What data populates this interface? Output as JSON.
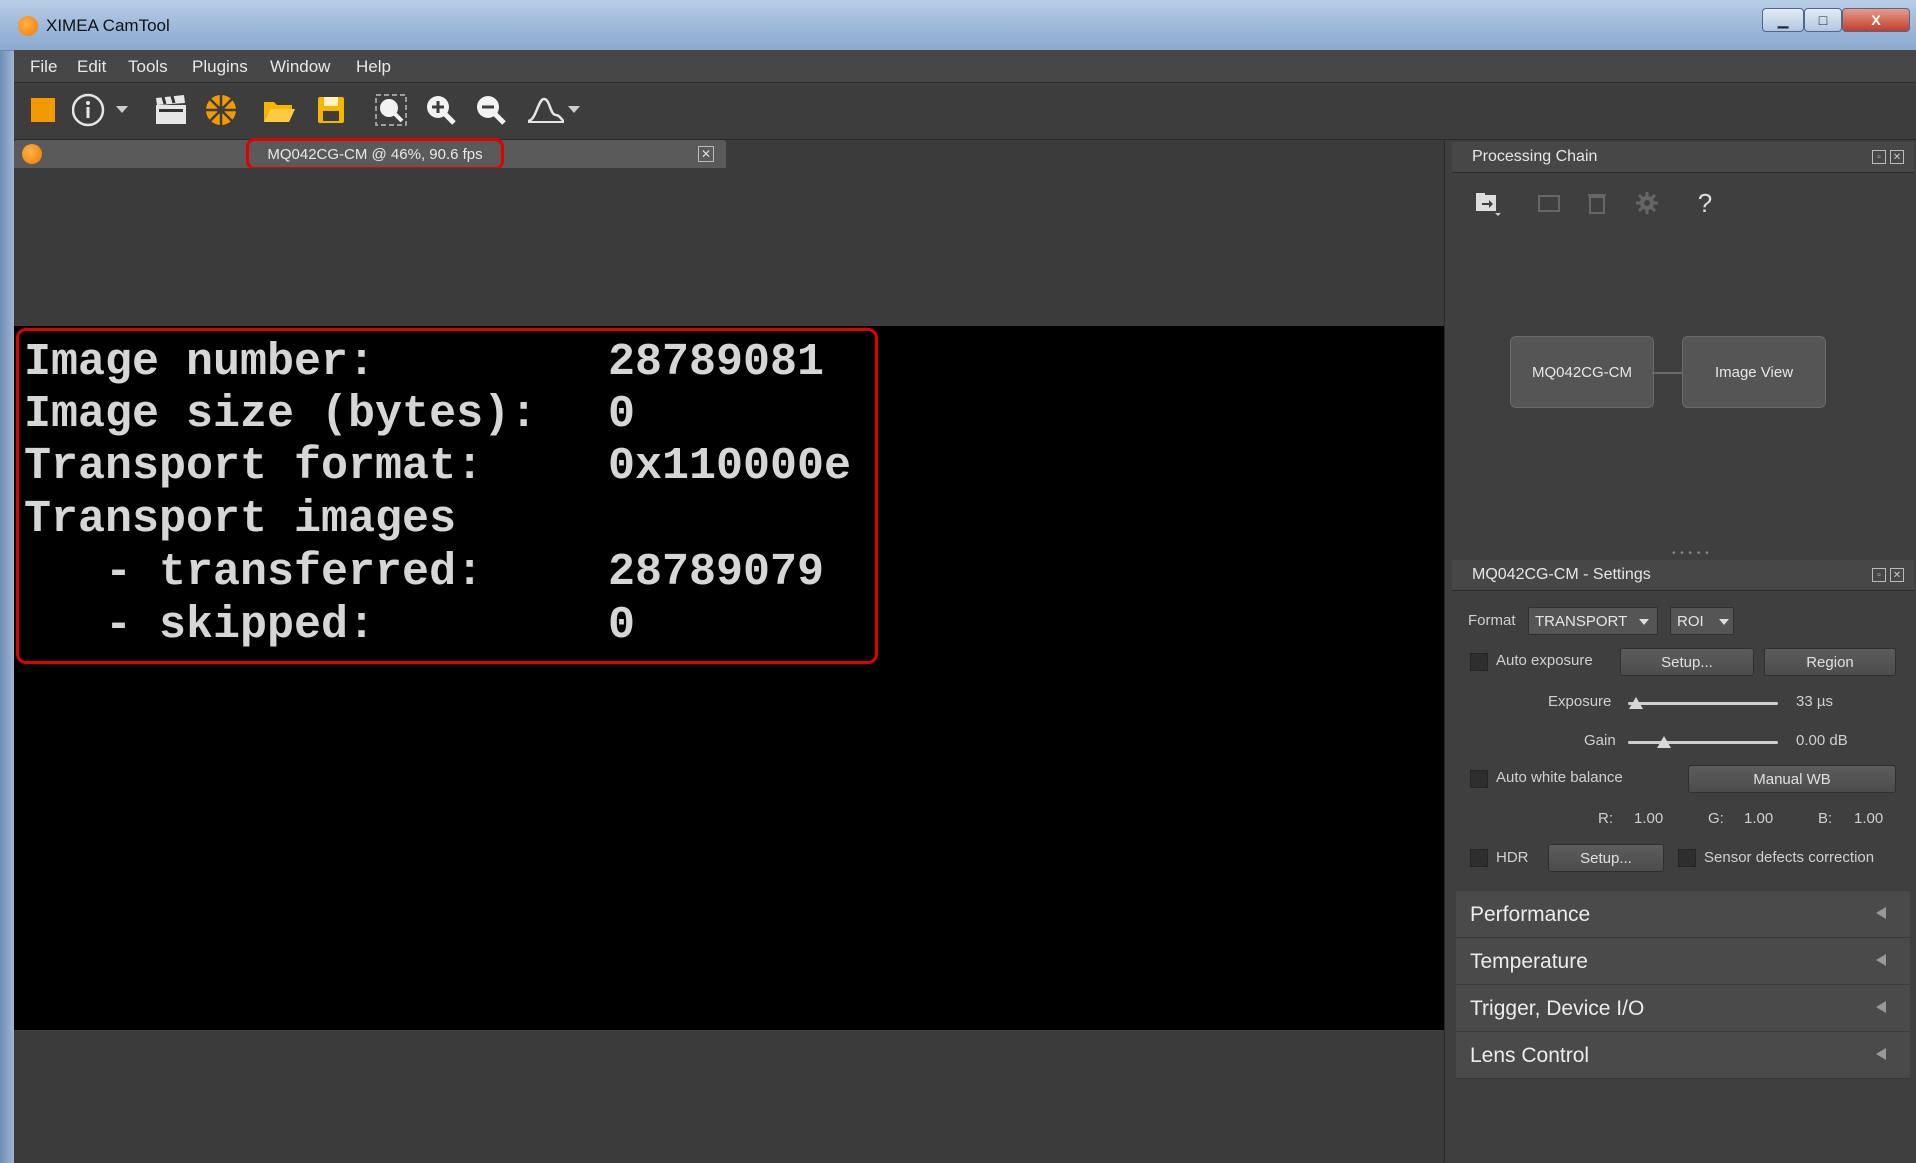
{
  "window": {
    "title": "XIMEA CamTool",
    "min_label": "▁",
    "max_label": "□",
    "close_label": "X"
  },
  "menu": [
    "File",
    "Edit",
    "Tools",
    "Plugins",
    "Window",
    "Help"
  ],
  "toolbar": {
    "icons": [
      "stop-icon",
      "info-icon",
      "record-icon",
      "aperture-icon",
      "open-folder-icon",
      "save-icon",
      "zoom-fit-icon",
      "zoom-in-icon",
      "zoom-out-icon",
      "histogram-icon"
    ]
  },
  "tab": {
    "label": "MQ042CG-CM @ 46%, 90.6 fps",
    "close_label": "✕"
  },
  "overlay": {
    "lines": [
      {
        "label": "Image number:",
        "value": "28789081"
      },
      {
        "label": "Image size (bytes):",
        "value": "0"
      },
      {
        "label": "Transport format:",
        "value": "0x110000e"
      },
      {
        "label": "Transport images",
        "value": ""
      },
      {
        "label": "   - transferred:",
        "value": "28789079"
      },
      {
        "label": "   - skipped:",
        "value": "0"
      }
    ]
  },
  "processing_chain": {
    "title": "Processing Chain",
    "help": "?",
    "nodes": [
      "MQ042CG-CM",
      "Image View"
    ]
  },
  "settings": {
    "title": "MQ042CG-CM - Settings",
    "format_label": "Format",
    "format_value": "TRANSPORT",
    "roi_label": "ROI",
    "auto_exposure_label": "Auto exposure",
    "setup_label": "Setup...",
    "region_label": "Region",
    "exposure_label": "Exposure",
    "exposure_value": "33 µs",
    "exposure_level": 0.05,
    "gain_label": "Gain",
    "gain_value": "0.00 dB",
    "gain_level": 0.24,
    "auto_wb_label": "Auto white balance",
    "manual_wb_label": "Manual WB",
    "r_label": "R:",
    "r_value": "1.00",
    "g_label": "G:",
    "g_value": "1.00",
    "b_label": "B:",
    "b_value": "1.00",
    "hdr_label": "HDR",
    "hdr_setup_label": "Setup...",
    "sensor_defects_label": "Sensor defects correction"
  },
  "sections": [
    "Performance",
    "Temperature",
    "Trigger, Device I/O",
    "Lens Control"
  ],
  "colors": {
    "highlight": "#e00000",
    "accent": "#f08c00"
  }
}
